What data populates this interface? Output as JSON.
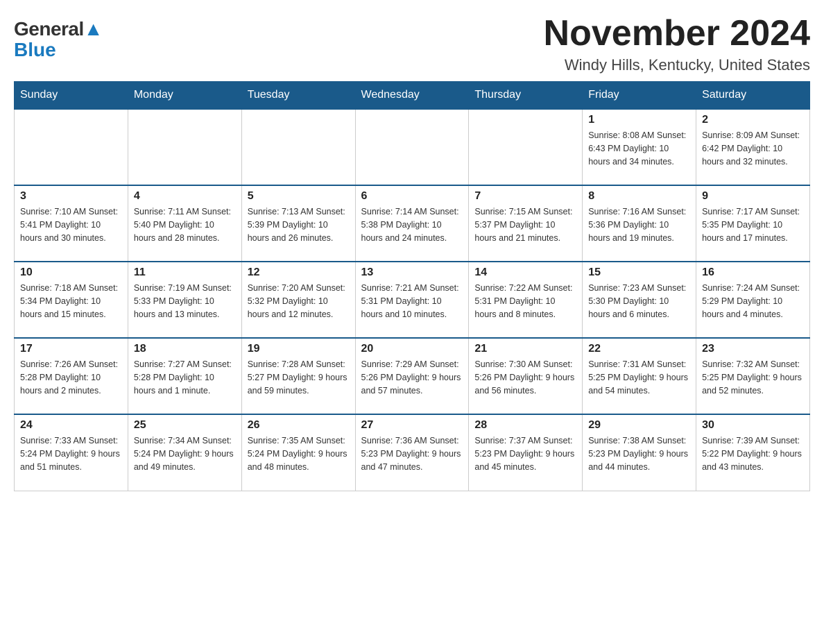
{
  "logo": {
    "general": "General",
    "blue": "Blue"
  },
  "title": "November 2024",
  "subtitle": "Windy Hills, Kentucky, United States",
  "days_of_week": [
    "Sunday",
    "Monday",
    "Tuesday",
    "Wednesday",
    "Thursday",
    "Friday",
    "Saturday"
  ],
  "weeks": [
    [
      {
        "day": "",
        "info": ""
      },
      {
        "day": "",
        "info": ""
      },
      {
        "day": "",
        "info": ""
      },
      {
        "day": "",
        "info": ""
      },
      {
        "day": "",
        "info": ""
      },
      {
        "day": "1",
        "info": "Sunrise: 8:08 AM\nSunset: 6:43 PM\nDaylight: 10 hours\nand 34 minutes."
      },
      {
        "day": "2",
        "info": "Sunrise: 8:09 AM\nSunset: 6:42 PM\nDaylight: 10 hours\nand 32 minutes."
      }
    ],
    [
      {
        "day": "3",
        "info": "Sunrise: 7:10 AM\nSunset: 5:41 PM\nDaylight: 10 hours\nand 30 minutes."
      },
      {
        "day": "4",
        "info": "Sunrise: 7:11 AM\nSunset: 5:40 PM\nDaylight: 10 hours\nand 28 minutes."
      },
      {
        "day": "5",
        "info": "Sunrise: 7:13 AM\nSunset: 5:39 PM\nDaylight: 10 hours\nand 26 minutes."
      },
      {
        "day": "6",
        "info": "Sunrise: 7:14 AM\nSunset: 5:38 PM\nDaylight: 10 hours\nand 24 minutes."
      },
      {
        "day": "7",
        "info": "Sunrise: 7:15 AM\nSunset: 5:37 PM\nDaylight: 10 hours\nand 21 minutes."
      },
      {
        "day": "8",
        "info": "Sunrise: 7:16 AM\nSunset: 5:36 PM\nDaylight: 10 hours\nand 19 minutes."
      },
      {
        "day": "9",
        "info": "Sunrise: 7:17 AM\nSunset: 5:35 PM\nDaylight: 10 hours\nand 17 minutes."
      }
    ],
    [
      {
        "day": "10",
        "info": "Sunrise: 7:18 AM\nSunset: 5:34 PM\nDaylight: 10 hours\nand 15 minutes."
      },
      {
        "day": "11",
        "info": "Sunrise: 7:19 AM\nSunset: 5:33 PM\nDaylight: 10 hours\nand 13 minutes."
      },
      {
        "day": "12",
        "info": "Sunrise: 7:20 AM\nSunset: 5:32 PM\nDaylight: 10 hours\nand 12 minutes."
      },
      {
        "day": "13",
        "info": "Sunrise: 7:21 AM\nSunset: 5:31 PM\nDaylight: 10 hours\nand 10 minutes."
      },
      {
        "day": "14",
        "info": "Sunrise: 7:22 AM\nSunset: 5:31 PM\nDaylight: 10 hours\nand 8 minutes."
      },
      {
        "day": "15",
        "info": "Sunrise: 7:23 AM\nSunset: 5:30 PM\nDaylight: 10 hours\nand 6 minutes."
      },
      {
        "day": "16",
        "info": "Sunrise: 7:24 AM\nSunset: 5:29 PM\nDaylight: 10 hours\nand 4 minutes."
      }
    ],
    [
      {
        "day": "17",
        "info": "Sunrise: 7:26 AM\nSunset: 5:28 PM\nDaylight: 10 hours\nand 2 minutes."
      },
      {
        "day": "18",
        "info": "Sunrise: 7:27 AM\nSunset: 5:28 PM\nDaylight: 10 hours\nand 1 minute."
      },
      {
        "day": "19",
        "info": "Sunrise: 7:28 AM\nSunset: 5:27 PM\nDaylight: 9 hours\nand 59 minutes."
      },
      {
        "day": "20",
        "info": "Sunrise: 7:29 AM\nSunset: 5:26 PM\nDaylight: 9 hours\nand 57 minutes."
      },
      {
        "day": "21",
        "info": "Sunrise: 7:30 AM\nSunset: 5:26 PM\nDaylight: 9 hours\nand 56 minutes."
      },
      {
        "day": "22",
        "info": "Sunrise: 7:31 AM\nSunset: 5:25 PM\nDaylight: 9 hours\nand 54 minutes."
      },
      {
        "day": "23",
        "info": "Sunrise: 7:32 AM\nSunset: 5:25 PM\nDaylight: 9 hours\nand 52 minutes."
      }
    ],
    [
      {
        "day": "24",
        "info": "Sunrise: 7:33 AM\nSunset: 5:24 PM\nDaylight: 9 hours\nand 51 minutes."
      },
      {
        "day": "25",
        "info": "Sunrise: 7:34 AM\nSunset: 5:24 PM\nDaylight: 9 hours\nand 49 minutes."
      },
      {
        "day": "26",
        "info": "Sunrise: 7:35 AM\nSunset: 5:24 PM\nDaylight: 9 hours\nand 48 minutes."
      },
      {
        "day": "27",
        "info": "Sunrise: 7:36 AM\nSunset: 5:23 PM\nDaylight: 9 hours\nand 47 minutes."
      },
      {
        "day": "28",
        "info": "Sunrise: 7:37 AM\nSunset: 5:23 PM\nDaylight: 9 hours\nand 45 minutes."
      },
      {
        "day": "29",
        "info": "Sunrise: 7:38 AM\nSunset: 5:23 PM\nDaylight: 9 hours\nand 44 minutes."
      },
      {
        "day": "30",
        "info": "Sunrise: 7:39 AM\nSunset: 5:22 PM\nDaylight: 9 hours\nand 43 minutes."
      }
    ]
  ]
}
